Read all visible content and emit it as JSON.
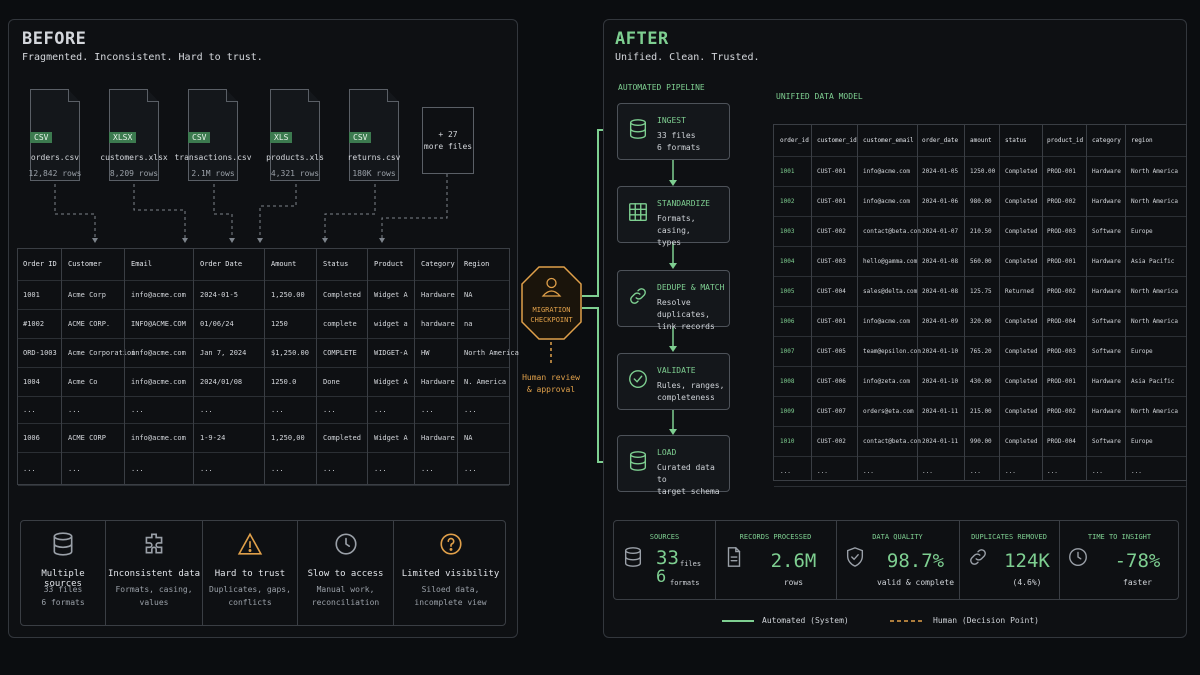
{
  "before": {
    "title": "BEFORE",
    "subtitle": "Fragmented. Inconsistent. Hard to trust.",
    "files": [
      {
        "badge": "CSV",
        "name": "orders.csv",
        "rows": "12,842 rows"
      },
      {
        "badge": "XLSX",
        "name": "customers.xlsx",
        "rows": "8,209 rows"
      },
      {
        "badge": "CSV",
        "name": "transactions.csv",
        "rows": "2.1M rows"
      },
      {
        "badge": "XLS",
        "name": "products.xls",
        "rows": "4,321 rows"
      },
      {
        "badge": "CSV",
        "name": "returns.csv",
        "rows": "180K rows"
      }
    ],
    "more_files": {
      "count": "+ 27",
      "label": "more files"
    },
    "table": {
      "headers": [
        "Order ID",
        "Customer",
        "Email",
        "Order Date",
        "Amount",
        "Status",
        "Product",
        "Category",
        "Region"
      ],
      "rows": [
        [
          "1001",
          "Acme Corp",
          "info@acme.com",
          "2024-01-5",
          "1,250.00",
          "Completed",
          "Widget A",
          "Hardware",
          "NA"
        ],
        [
          "#1002",
          "ACME CORP.",
          "INFO@ACME.COM",
          "01/06/24",
          "1250",
          "complete",
          "widget a",
          "hardware",
          "na"
        ],
        [
          "ORD-1003",
          "Acme Corporation",
          "info@acme.com",
          "Jan 7, 2024",
          "$1,250.00",
          "COMPLETE",
          "WIDGET-A",
          "HW",
          "North America"
        ],
        [
          "1004",
          "Acme  Co",
          "info@acme.com",
          "2024/01/08",
          "1250.0",
          "Done",
          "Widget A",
          "Hardware",
          "N. America"
        ],
        [
          "...",
          "...",
          "...",
          "...",
          "...",
          "...",
          "...",
          "...",
          "..."
        ],
        [
          "1006",
          "ACME CORP",
          "info@acme.com",
          "1-9-24",
          "1,250,00",
          "Completed",
          "Widget A",
          "Hardware",
          "NA"
        ],
        [
          "...",
          "...",
          "...",
          "...",
          "...",
          "...",
          "...",
          "...",
          "..."
        ]
      ]
    },
    "pains": [
      {
        "icon": "database-icon",
        "title": "Multiple sources",
        "l1": "33 files",
        "l2": "6 formats"
      },
      {
        "icon": "puzzle-icon",
        "title": "Inconsistent data",
        "l1": "Formats, casing,",
        "l2": "values"
      },
      {
        "icon": "warning-icon",
        "title": "Hard to trust",
        "l1": "Duplicates, gaps,",
        "l2": "conflicts"
      },
      {
        "icon": "clock-icon",
        "title": "Slow to access",
        "l1": "Manual work,",
        "l2": "reconciliation"
      },
      {
        "icon": "question-icon",
        "title": "Limited visibility",
        "l1": "Siloed data,",
        "l2": "incomplete view"
      }
    ]
  },
  "checkpoint": {
    "line1": "MIGRATION",
    "line2": "CHECKPOINT",
    "note1": "Human review",
    "note2": "& approval"
  },
  "after": {
    "title": "AFTER",
    "subtitle": "Unified. Clean. Trusted.",
    "pipeline_label": "AUTOMATED PIPELINE",
    "model_label": "UNIFIED DATA MODEL",
    "steps": [
      {
        "icon": "database-icon",
        "title": "INGEST",
        "d1": "33 files",
        "d2": "6 formats"
      },
      {
        "icon": "table-icon",
        "title": "STANDARDIZE",
        "d1": "Formats, casing,",
        "d2": "types"
      },
      {
        "icon": "link-icon",
        "title": "DEDUPE & MATCH",
        "d1": "Resolve duplicates,",
        "d2": "link records"
      },
      {
        "icon": "check-circle-icon",
        "title": "VALIDATE",
        "d1": "Rules, ranges,",
        "d2": "completeness"
      },
      {
        "icon": "database-icon",
        "title": "LOAD",
        "d1": "Curated data to",
        "d2": "target schema"
      }
    ],
    "table": {
      "headers": [
        "order_id",
        "customer_id",
        "customer_email",
        "order_date",
        "amount",
        "status",
        "product_id",
        "category",
        "region"
      ],
      "rows": [
        [
          "1001",
          "CUST-001",
          "info@acme.com",
          "2024-01-05",
          "1250.00",
          "Completed",
          "PROD-001",
          "Hardware",
          "North America"
        ],
        [
          "1002",
          "CUST-001",
          "info@acme.com",
          "2024-01-06",
          "980.00",
          "Completed",
          "PROD-002",
          "Hardware",
          "North America"
        ],
        [
          "1003",
          "CUST-002",
          "contact@beta.com",
          "2024-01-07",
          "210.50",
          "Completed",
          "PROD-003",
          "Software",
          "Europe"
        ],
        [
          "1004",
          "CUST-003",
          "hello@gamma.com",
          "2024-01-08",
          "560.00",
          "Completed",
          "PROD-001",
          "Hardware",
          "Asia Pacific"
        ],
        [
          "1005",
          "CUST-004",
          "sales@delta.com",
          "2024-01-08",
          "125.75",
          "Returned",
          "PROD-002",
          "Hardware",
          "North America"
        ],
        [
          "1006",
          "CUST-001",
          "info@acme.com",
          "2024-01-09",
          "320.00",
          "Completed",
          "PROD-004",
          "Software",
          "North America"
        ],
        [
          "1007",
          "CUST-005",
          "team@epsilon.com",
          "2024-01-10",
          "765.20",
          "Completed",
          "PROD-003",
          "Software",
          "Europe"
        ],
        [
          "1008",
          "CUST-006",
          "info@zeta.com",
          "2024-01-10",
          "430.00",
          "Completed",
          "PROD-001",
          "Hardware",
          "Asia Pacific"
        ],
        [
          "1009",
          "CUST-007",
          "orders@eta.com",
          "2024-01-11",
          "215.00",
          "Completed",
          "PROD-002",
          "Hardware",
          "North America"
        ],
        [
          "1010",
          "CUST-002",
          "contact@beta.com",
          "2024-01-11",
          "990.00",
          "Completed",
          "PROD-004",
          "Software",
          "Europe"
        ],
        [
          "...",
          "...",
          "...",
          "...",
          "...",
          "...",
          "...",
          "...",
          "..."
        ]
      ]
    },
    "stats": [
      {
        "icon": "database-icon",
        "label": "SOURCES",
        "v1": "33",
        "s1": "files",
        "v2": "6",
        "s2": "formats"
      },
      {
        "icon": "document-icon",
        "label": "RECORDS PROCESSED",
        "value": "2.6M",
        "sub": "rows"
      },
      {
        "icon": "shield-check-icon",
        "label": "DATA QUALITY",
        "value": "98.7%",
        "sub": "valid & complete"
      },
      {
        "icon": "link-icon",
        "label": "DUPLICATES REMOVED",
        "value": "124K",
        "sub": "(4.6%)"
      },
      {
        "icon": "clock-icon",
        "label": "TIME TO INSIGHT",
        "value": "-78%",
        "sub": "faster"
      }
    ],
    "legend": {
      "automated": "Automated (System)",
      "human": "Human (Decision Point)"
    }
  },
  "colors": {
    "accent": "#7ecf91",
    "human": "#e0a04a",
    "border": "#3a3e44"
  }
}
